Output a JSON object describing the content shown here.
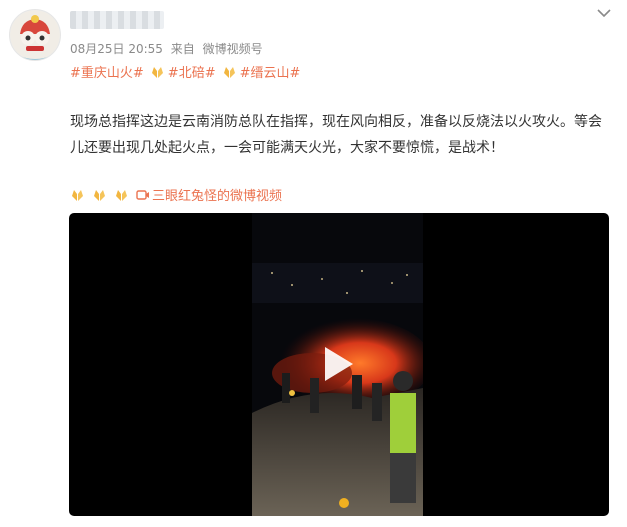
{
  "post": {
    "date": "08月25日 20:55",
    "source_prefix": "来自",
    "source": "微博视频号",
    "tags": [
      "#重庆山火#",
      "#北碚#",
      "#缙云山#"
    ],
    "content_line1": "现场总指挥这边是云南消防总队在指挥，现在风向相反，准备以反烧法以火攻火。等会",
    "content_line2": "儿还要出现几处起火点，一会可能满天火光，大家不要惊慌，是战术！",
    "video_source_label": "三眼红兔怪的微博视频"
  },
  "icons": {
    "menu": "chevron-down-icon",
    "hands": "praying-hands-emoji",
    "video_link": "video-link-icon",
    "play": "play-icon"
  },
  "colors": {
    "link": "#eb7350",
    "meta": "#8a8a8a",
    "text": "#333333",
    "video_bg": "#000000"
  }
}
